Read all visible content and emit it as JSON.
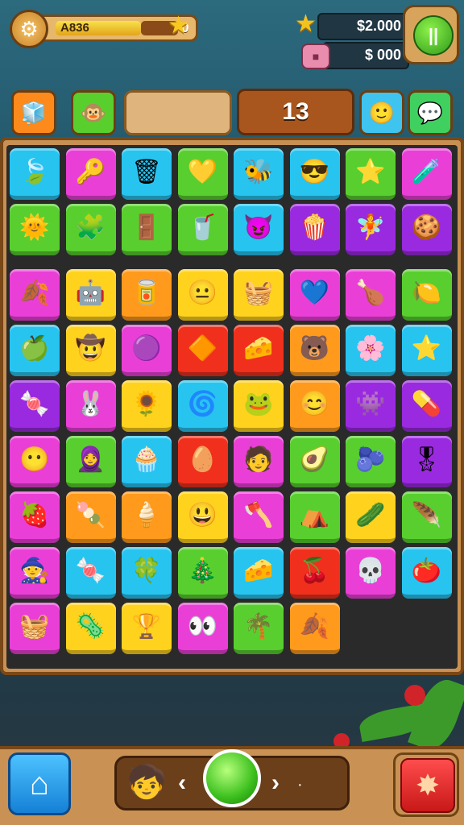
{
  "hud": {
    "settings_icon": "gear-icon",
    "level_label": "A836",
    "level_progress": 0.7,
    "level_count": "0",
    "star_icon": "star-icon",
    "coins": "$2.000",
    "gems": "$ 000",
    "pause_label": "||"
  },
  "toolbar": {
    "slots_left": [
      {
        "icon": "cube-icon",
        "glyph": "🧊",
        "color": "#ff8a1c"
      },
      {
        "icon": "creature-icon",
        "glyph": "🐵",
        "color": "#59cf2e"
      }
    ],
    "moves": "13",
    "slots_right": [
      {
        "icon": "face-icon",
        "glyph": "🙂",
        "color": "#3fc4f0"
      },
      {
        "icon": "chat-icon",
        "glyph": "💬",
        "color": "#3fd060"
      }
    ]
  },
  "board": {
    "rows": [
      [
        [
          "c-blue",
          "🍃"
        ],
        [
          "c-mag",
          "🔑"
        ],
        [
          "c-blue",
          "🗑"
        ],
        [
          "c-green",
          "💛"
        ],
        [
          "c-blue",
          "🐝"
        ],
        [
          "c-blue",
          "😎"
        ],
        [
          "c-green",
          "⭐"
        ],
        [
          "c-mag",
          "🧪"
        ]
      ],
      [
        [
          "c-green",
          "🌞"
        ],
        [
          "c-green",
          "🧩"
        ],
        [
          "c-green",
          "🚪"
        ],
        [
          "c-green",
          "🥤"
        ],
        [
          "c-blue",
          "😈"
        ],
        [
          "c-purple",
          "🍿"
        ],
        [
          "c-purple",
          "🧚"
        ],
        [
          "c-purple",
          "🍪"
        ]
      ],
      [
        [
          "c-mag",
          "🍂"
        ],
        [
          "c-yellow",
          "🤖"
        ],
        [
          "c-orange",
          "🥫"
        ],
        [
          "c-yellow",
          "😐"
        ],
        [
          "c-yellow",
          "🧺"
        ],
        [
          "c-mag",
          "💙"
        ],
        [
          "c-mag",
          "🍗"
        ],
        [
          "c-green",
          "🍋"
        ]
      ],
      [
        [
          "c-blue",
          "🍏"
        ],
        [
          "c-yellow",
          "🤠"
        ],
        [
          "c-mag",
          "🟣"
        ],
        [
          "c-red",
          "🔶"
        ],
        [
          "c-red",
          "🧀"
        ],
        [
          "c-orange",
          "🐻"
        ],
        [
          "c-blue",
          "🌸"
        ],
        [
          "c-blue",
          "⭐"
        ]
      ],
      [
        [
          "c-purple",
          "🍬"
        ],
        [
          "c-mag",
          "🐰"
        ],
        [
          "c-yellow",
          "🌻"
        ],
        [
          "c-blue",
          "🌀"
        ],
        [
          "c-yellow",
          "🐸"
        ],
        [
          "c-orange",
          "😊"
        ],
        [
          "c-purple",
          "👾"
        ],
        [
          "c-purple",
          "💊"
        ]
      ],
      [
        [
          "c-mag",
          "😶"
        ],
        [
          "c-green",
          "🧕"
        ],
        [
          "c-blue",
          "🧁"
        ],
        [
          "c-red",
          "🥚"
        ],
        [
          "c-mag",
          "🧑"
        ],
        [
          "c-green",
          "🥑"
        ],
        [
          "c-green",
          "🫐"
        ],
        [
          "c-purple",
          "🎖"
        ]
      ],
      [
        [
          "c-mag",
          "🍓"
        ],
        [
          "c-orange",
          "🍡"
        ],
        [
          "c-orange",
          "🍦"
        ],
        [
          "c-yellow",
          "😃"
        ],
        [
          "c-mag",
          "🪓"
        ],
        [
          "c-green",
          "⛺"
        ],
        [
          "c-yellow",
          "🥒"
        ],
        [
          "c-green",
          "🪶"
        ]
      ],
      [
        [
          "c-mag",
          "🧙"
        ],
        [
          "c-blue",
          "🍬"
        ],
        [
          "c-blue",
          "🍀"
        ],
        [
          "c-green",
          "🎄"
        ],
        [
          "c-blue",
          "🧀"
        ],
        [
          "c-red",
          "🍒"
        ],
        [
          "c-mag",
          "💀"
        ],
        [
          "c-blue",
          "🍅"
        ]
      ],
      [
        [
          "c-mag",
          "🧺"
        ],
        [
          "c-yellow",
          "🦠"
        ],
        [
          "c-yellow",
          "🏆"
        ],
        [
          "c-mag",
          "👀"
        ],
        [
          "c-green",
          "🌴"
        ],
        [
          "c-orange",
          "🍂"
        ]
      ]
    ]
  },
  "bottom": {
    "home_icon": "home-icon",
    "prev_label": "‹",
    "next_label": "›",
    "dot_label": "·",
    "character_icon": "character-icon",
    "orb_icon": "green-orb-icon",
    "boost_icon": "star-burst-icon"
  }
}
